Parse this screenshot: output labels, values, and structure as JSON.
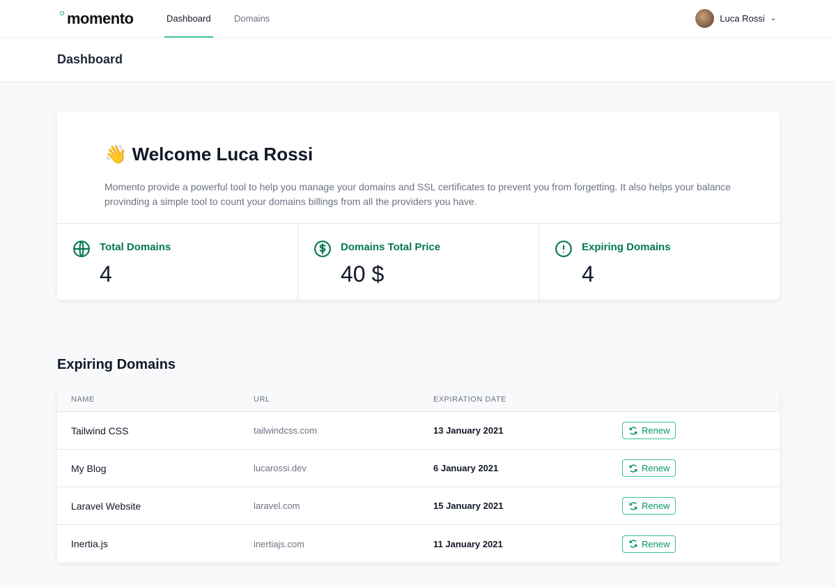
{
  "nav": {
    "logo": "momento",
    "links": [
      "Dashboard",
      "Domains"
    ],
    "user": "Luca Rossi"
  },
  "header": {
    "title": "Dashboard"
  },
  "welcome": {
    "emoji": "👋",
    "title": "Welcome Luca Rossi",
    "text": "Momento provide a powerful tool to help you manage your domains and SSL certificates to prevent you from forgetting. It also helps your balance provinding a simple tool to count your domains billings from all the providers you have."
  },
  "stats": [
    {
      "label": "Total Domains",
      "value": "4",
      "icon": "globe-icon"
    },
    {
      "label": "Domains Total Price",
      "value": "40 $",
      "icon": "dollar-icon"
    },
    {
      "label": "Expiring Domains",
      "value": "4",
      "icon": "exclamation-icon"
    }
  ],
  "expiring": {
    "title": "Expiring Domains",
    "columns": [
      "NAME",
      "URL",
      "EXPIRATION DATE"
    ],
    "renew_label": "Renew",
    "rows": [
      {
        "name": "Tailwind CSS",
        "url": "tailwindcss.com",
        "date": "13 January 2021"
      },
      {
        "name": "My Blog",
        "url": "lucarossi.dev",
        "date": "6 January 2021"
      },
      {
        "name": "Laravel Website",
        "url": "laravel.com",
        "date": "15 January 2021"
      },
      {
        "name": "Inertia.js",
        "url": "inertiajs.com",
        "date": "11 January 2021"
      }
    ]
  },
  "colors": {
    "accent": "#047857",
    "underline": "#3bbf9a"
  }
}
